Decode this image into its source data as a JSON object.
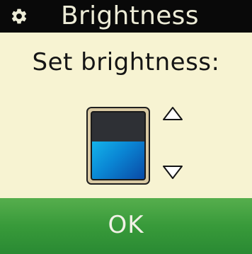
{
  "window": {
    "title": "Brightness",
    "icon": "gear-icon"
  },
  "main": {
    "prompt": "Set brightness:",
    "brightness_level": 0.56,
    "increase_icon": "triangle-up-icon",
    "decrease_icon": "triangle-down-icon"
  },
  "footer": {
    "ok_label": "OK"
  },
  "colors": {
    "titlebar": "#090909",
    "background": "#f7f3d2",
    "level_fill": "#0a86d4",
    "level_empty": "#2e3035",
    "ok_button": "#389a3a"
  }
}
